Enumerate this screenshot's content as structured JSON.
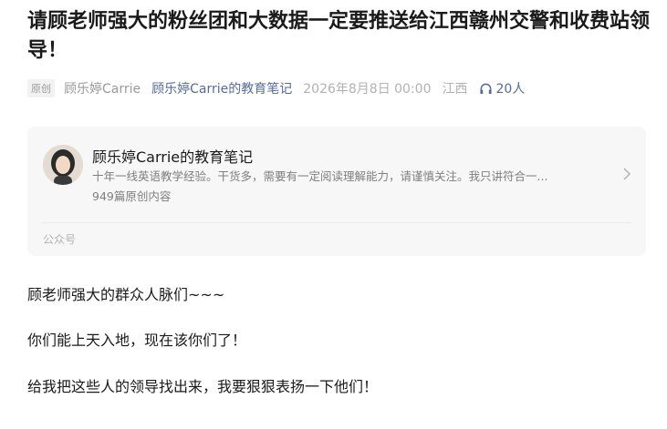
{
  "article": {
    "title": "请顾老师强大的粉丝团和大数据一定要推送给江西赣州交警和收费站领导！",
    "meta": {
      "badge": "原创",
      "author": "顾乐婷Carrie",
      "account": "顾乐婷Carrie的教育笔记",
      "date": "2026年8月8日 00:00",
      "region": "江西",
      "listen_count": "20人"
    }
  },
  "profile_card": {
    "name": "顾乐婷Carrie的教育笔记",
    "description": "十年一线英语教学经验。干货多，需要有一定阅读理解能力，请谨慎关注。我只讲符合一...",
    "article_count": "949篇原创内容",
    "footer": "公众号"
  },
  "body": {
    "paragraphs": [
      "顾老师强大的群众人脉们~~~",
      "你们能上天入地，现在该你们了！",
      "给我把这些人的领导找出来，我要狠狠表扬一下他们！"
    ]
  },
  "icons": {
    "listen": "headphones-icon",
    "card_arrow": "chevron-right-icon"
  },
  "colors": {
    "link": "#576b95",
    "meta_gray": "#b2b2b2",
    "card_bg": "#f7f7f7"
  }
}
